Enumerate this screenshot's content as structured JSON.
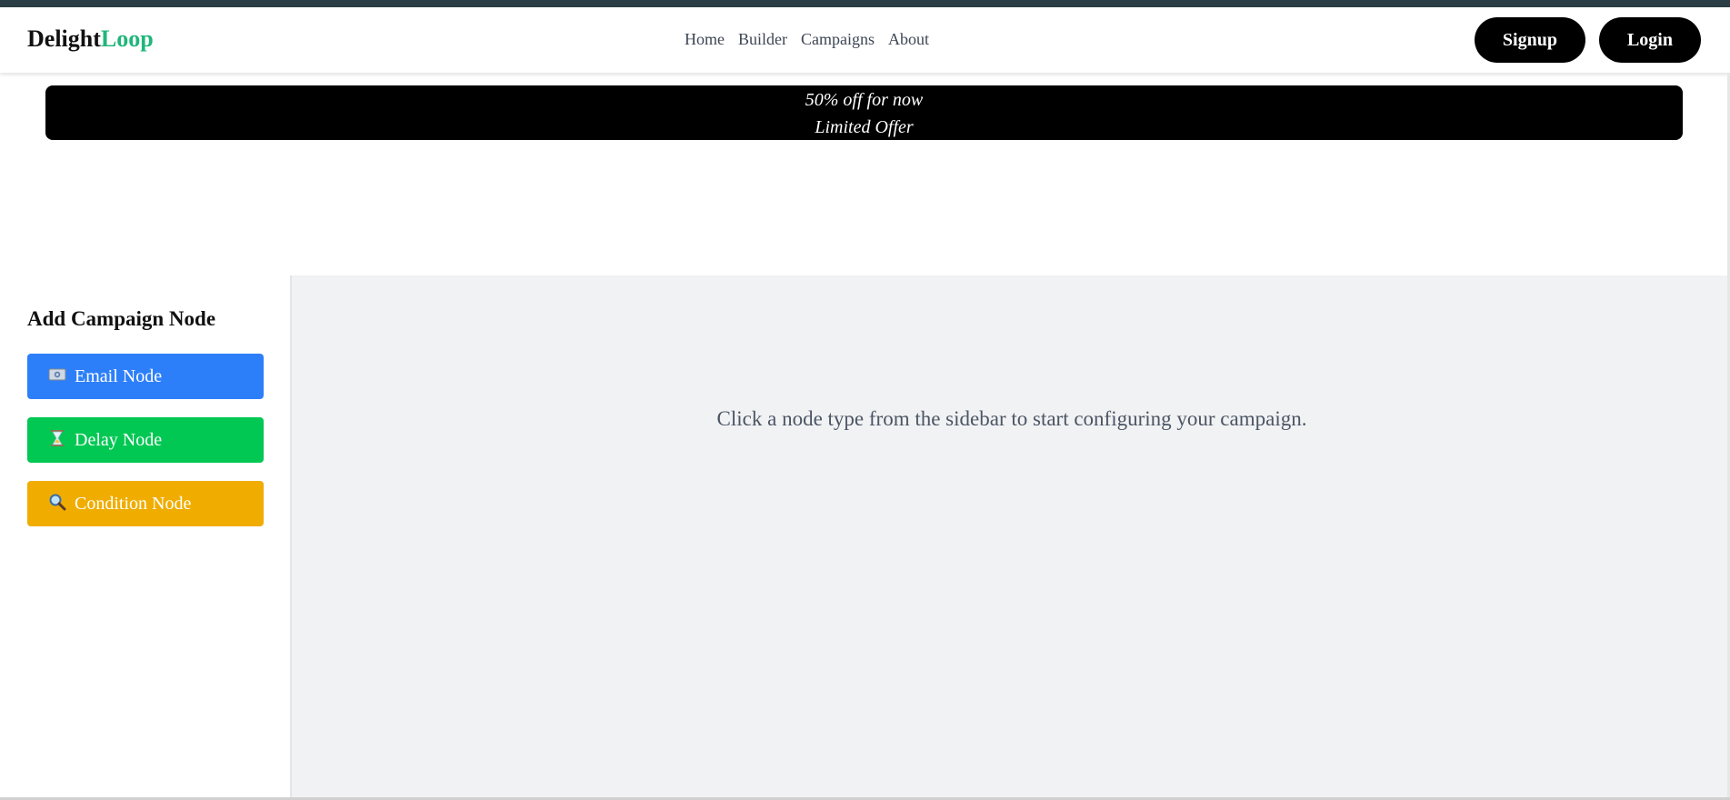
{
  "brand": {
    "part1": "Delight",
    "part2": "Loop",
    "color_accent": "#1fb67a"
  },
  "nav": {
    "links": [
      "Home",
      "Builder",
      "Campaigns",
      "About"
    ]
  },
  "auth": {
    "signup_label": "Signup",
    "login_label": "Login"
  },
  "offer": {
    "line1": "50% off for now",
    "line2": "Limited Offer"
  },
  "sidebar": {
    "title": "Add Campaign Node",
    "nodes": [
      {
        "label": "Email Node",
        "icon": "email-icon",
        "color": "#2d7ff9"
      },
      {
        "label": "Delay Node",
        "icon": "hourglass-icon",
        "color": "#00c853"
      },
      {
        "label": "Condition Node",
        "icon": "magnifier-icon",
        "color": "#f0ad00"
      }
    ]
  },
  "main": {
    "hint": "Click a node type from the sidebar to start configuring your campaign."
  }
}
